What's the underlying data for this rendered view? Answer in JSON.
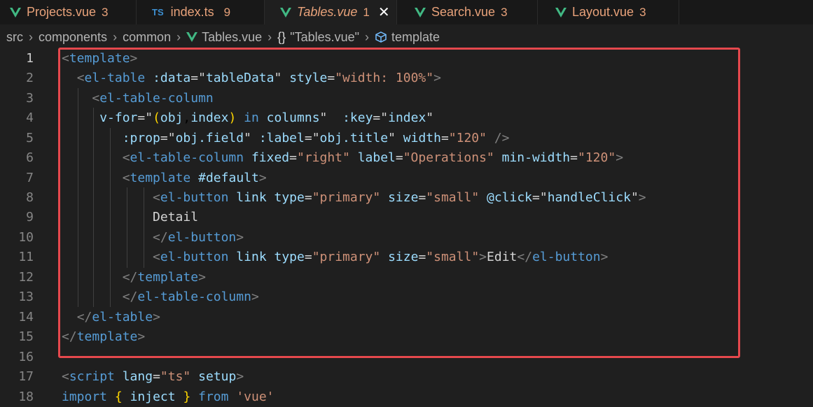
{
  "tabs": [
    {
      "name": "Projects.vue",
      "count": "3",
      "icon": "vue-icon"
    },
    {
      "name": "index.ts",
      "count": "9",
      "icon": "typescript-icon",
      "badge": "TS"
    },
    {
      "name": "Tables.vue",
      "count": "1",
      "icon": "vue-icon",
      "close": "✕",
      "active": true
    },
    {
      "name": "Search.vue",
      "count": "3",
      "icon": "vue-icon"
    },
    {
      "name": "Layout.vue",
      "count": "3",
      "icon": "vue-icon"
    }
  ],
  "breadcrumb": {
    "parts": [
      "src",
      "components",
      "common",
      "Tables.vue"
    ],
    "braces": "{}",
    "symbol": "\"Tables.vue\"",
    "last": "template"
  },
  "lines": [
    {
      "n": "1",
      "text": "<template>"
    },
    {
      "n": "2",
      "text": "  <el-table :data=\"tableData\" style=\"width: 100%\">"
    },
    {
      "n": "3",
      "text": "    <el-table-column"
    },
    {
      "n": "4",
      "text": "     v-for=\"(obj,index) in columns\"  :key=\"index\""
    },
    {
      "n": "5",
      "text": "        :prop=\"obj.field\" :label=\"obj.title\" width=\"120\" />"
    },
    {
      "n": "6",
      "text": "        <el-table-column fixed=\"right\" label=\"Operations\" min-width=\"120\">"
    },
    {
      "n": "7",
      "text": "        <template #default>"
    },
    {
      "n": "8",
      "text": "            <el-button link type=\"primary\" size=\"small\" @click=\"handleClick\">"
    },
    {
      "n": "9",
      "text": "            Detail"
    },
    {
      "n": "10",
      "text": "            </el-button>"
    },
    {
      "n": "11",
      "text": "            <el-button link type=\"primary\" size=\"small\">Edit</el-button>"
    },
    {
      "n": "12",
      "text": "        </template>"
    },
    {
      "n": "13",
      "text": "        </el-table-column>"
    },
    {
      "n": "14",
      "text": "  </el-table>"
    },
    {
      "n": "15",
      "text": "</template>"
    },
    {
      "n": "16",
      "text": ""
    },
    {
      "n": "17",
      "text": "<script lang=\"ts\" setup>"
    },
    {
      "n": "18",
      "text": "import { inject } from 'vue'"
    }
  ],
  "colors": {
    "accent": "#e5484d",
    "tag": "#569cd6",
    "attr": "#9cdcfe",
    "string": "#ce9178",
    "bracket": "#808080",
    "vue": "#41b883"
  }
}
